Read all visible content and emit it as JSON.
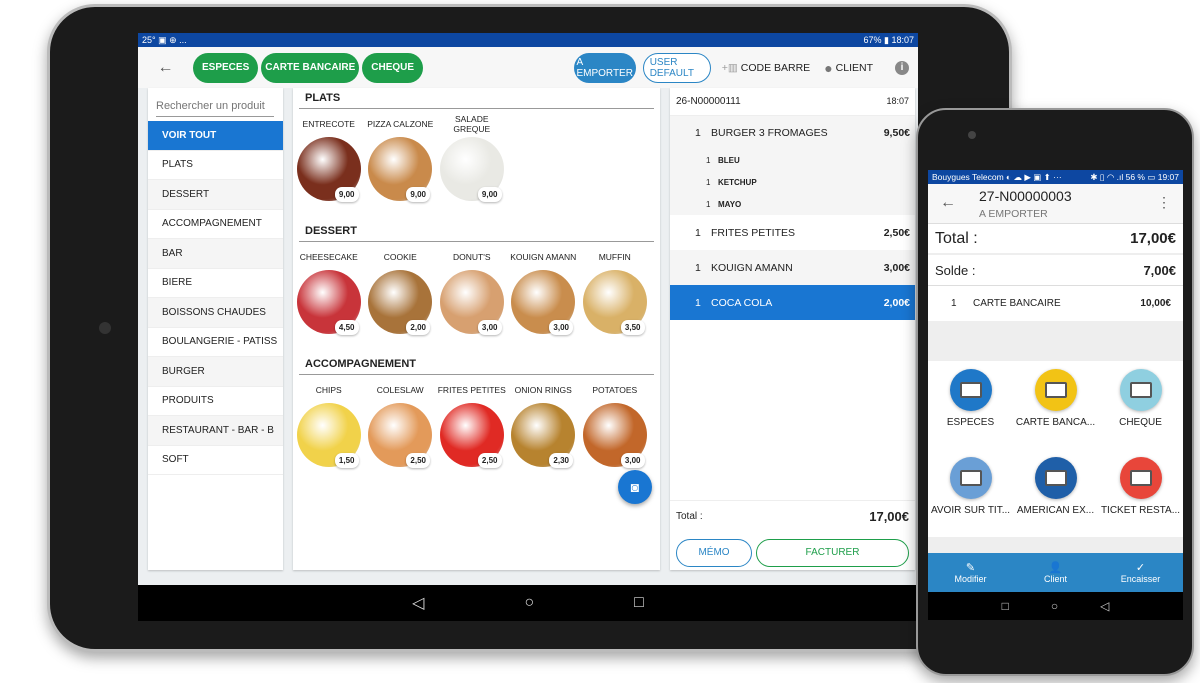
{
  "tablet": {
    "status": {
      "left": "25° ▣ ⊕ ...",
      "right": "67% ▮ 18:07"
    },
    "header": {
      "payment_buttons": [
        "ESPECES",
        "CARTE BANCAIRE",
        "CHEQUE"
      ],
      "takeaway": "A EMPORTER",
      "user": "USER DEFAULT",
      "barcode": "CODE BARRE",
      "client": "CLIENT"
    },
    "search_placeholder": "Rechercher un produit",
    "categories": [
      "VOIR TOUT",
      "PLATS",
      "DESSERT",
      "ACCOMPAGNEMENT",
      "BAR",
      "BIERE",
      "BOISSONS CHAUDES",
      "BOULANGERIE - PATISS",
      "BURGER",
      "PRODUITS",
      "RESTAURANT - BAR - B",
      "SOFT"
    ],
    "sections": [
      {
        "title": "PLATS",
        "products": [
          {
            "name": "ENTRECOTE",
            "price": "9,00",
            "color": "#7a2f1d"
          },
          {
            "name": "PIZZA CALZONE",
            "price": "9,00",
            "color": "#c98a4b"
          },
          {
            "name": "SALADE GREQUE",
            "price": "9,00",
            "color": "#e9e9e4"
          }
        ]
      },
      {
        "title": "DESSERT",
        "products": [
          {
            "name": "CHEESECAKE",
            "price": "4,50",
            "color": "#c8343a"
          },
          {
            "name": "COOKIE",
            "price": "2,00",
            "color": "#a8733a"
          },
          {
            "name": "DONUT'S",
            "price": "3,00",
            "color": "#d7a070"
          },
          {
            "name": "KOUIGN AMANN",
            "price": "3,00",
            "color": "#c98d4d"
          },
          {
            "name": "MUFFIN",
            "price": "3,50",
            "color": "#d9b167"
          }
        ]
      },
      {
        "title": "ACCOMPAGNEMENT",
        "products": [
          {
            "name": "CHIPS",
            "price": "1,50",
            "color": "#f1d24a"
          },
          {
            "name": "COLESLAW",
            "price": "2,50",
            "color": "#e39a5a"
          },
          {
            "name": "FRITES PETITES",
            "price": "2,50",
            "color": "#e02a24"
          },
          {
            "name": "ONION RINGS",
            "price": "2,30",
            "color": "#b7832f"
          },
          {
            "name": "POTATOES",
            "price": "3,00",
            "color": "#c2672a"
          }
        ]
      }
    ],
    "ticket": {
      "number": "26-N00000111",
      "time": "18:07",
      "lines": [
        {
          "qty": "1",
          "name": "BURGER 3 FROMAGES",
          "price": "9,50€",
          "subs": [
            {
              "qty": "1",
              "name": "BLEU"
            },
            {
              "qty": "1",
              "name": "KETCHUP"
            },
            {
              "qty": "1",
              "name": "MAYO"
            }
          ]
        },
        {
          "qty": "1",
          "name": "FRITES PETITES",
          "price": "2,50€"
        },
        {
          "qty": "1",
          "name": "KOUIGN AMANN",
          "price": "3,00€"
        },
        {
          "qty": "1",
          "name": "COCA COLA",
          "price": "2,00€",
          "selected": true
        }
      ],
      "total_label": "Total :",
      "total": "17,00€",
      "memo": "MÉMO",
      "invoice": "FACTURER"
    },
    "colors": {
      "status": "#0d47a1",
      "green": "#1e9e4a",
      "blue": "#1976d2"
    }
  },
  "phone": {
    "status": {
      "left": "Bouygues Telecom ◐ ☁ ▶ ▣ ⬆ ···",
      "right": "✱ ▯ ◠ .ıl 56 % ▭ 19:07"
    },
    "order": "27-N00000003",
    "mode": "A EMPORTER",
    "total_label": "Total :",
    "total": "17,00€",
    "balance_label": "Solde :",
    "balance": "7,00€",
    "payment": {
      "qty": "1",
      "name": "CARTE BANCAIRE",
      "amount": "10,00€"
    },
    "methods": [
      {
        "name": "ESPECES",
        "color": "#1f78c8"
      },
      {
        "name": "CARTE BANCA...",
        "color": "#f2c315"
      },
      {
        "name": "CHEQUE",
        "color": "#8fcfe0"
      },
      {
        "name": "AVOIR SUR TIT...",
        "color": "#6a9fd6"
      },
      {
        "name": "AMERICAN EX...",
        "color": "#1f5fa8"
      },
      {
        "name": "TICKET RESTA...",
        "color": "#e8463a"
      }
    ],
    "bottom": [
      {
        "label": "Modifier",
        "icon": "✎"
      },
      {
        "label": "Client",
        "icon": "👤"
      },
      {
        "label": "Encaisser",
        "icon": "✓"
      }
    ]
  }
}
